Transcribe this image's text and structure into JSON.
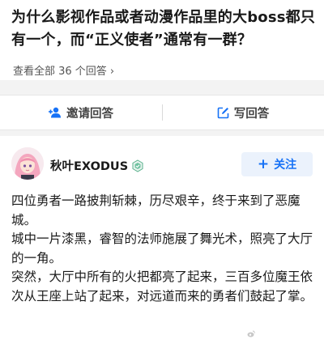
{
  "question": {
    "title": "为什么影视作品或者动漫作品里的大boss都只有一个，而“正义使者”通常有一群？",
    "answers_link": "查看全部 36 个回答"
  },
  "actions": {
    "invite": "邀请回答",
    "write": "写回答"
  },
  "answer": {
    "author": "秋叶EXODUS",
    "follow": "关注",
    "paragraphs": [
      "四位勇者一路披荆斩棘，历尽艰辛，终于来到了恶魔城。",
      "城中一片漆黑，睿智的法师施展了舞光术，照亮了大厅的一角。",
      "突然，大厅中所有的火把都亮了起来，三百多位魔王依次从王座上站了起来，对远道而来的勇者们鼓起了掌。"
    ]
  },
  "colors": {
    "accent": "#1772f6",
    "follow_bg": "#ebf2fc",
    "page_bg": "#f3f3f3"
  },
  "icons": {
    "invite": "add-user-icon",
    "write": "edit-icon",
    "more": "chevron-right-icon",
    "badge": "verified-badge-icon"
  }
}
